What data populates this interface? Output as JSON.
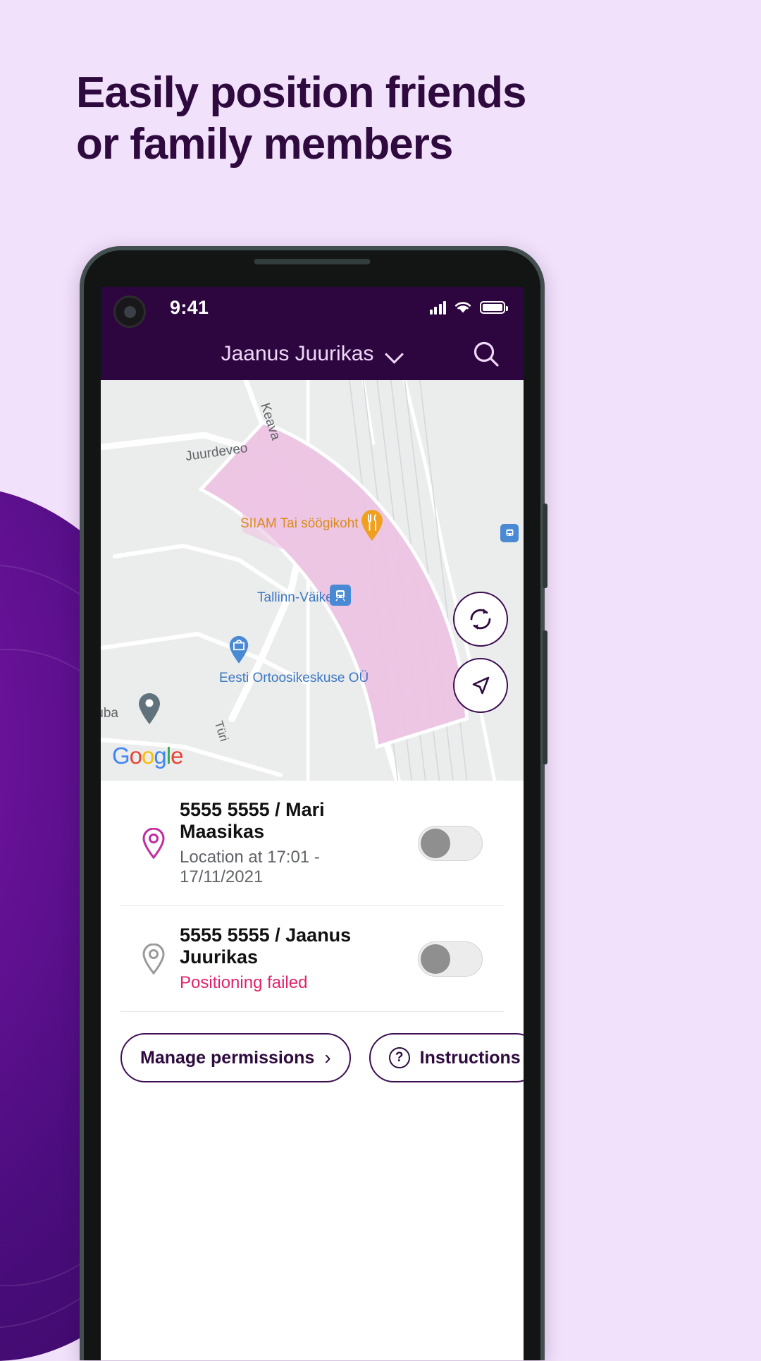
{
  "promo": {
    "headline_line1": "Easily position friends",
    "headline_line2": "or family members",
    "bg_color": "#f2e1fb",
    "text_color": "#2e0a3e"
  },
  "status_bar": {
    "time": "9:41",
    "signal_icon": "cellular-signal-icon",
    "wifi_icon": "wifi-icon",
    "battery_icon": "battery-full-icon"
  },
  "app_header": {
    "title": "Jaanus Juurikas",
    "dropdown_icon": "chevron-down-icon",
    "search_icon": "search-icon",
    "bg_color": "#2d0640"
  },
  "map": {
    "labels": [
      {
        "text": "Keava",
        "type": "street"
      },
      {
        "text": "Juurdeveo",
        "type": "street"
      },
      {
        "text": "SIIAM Tai söögikoht",
        "type": "poi-restaurant"
      },
      {
        "text": "Tallinn-Väike",
        "type": "poi-station"
      },
      {
        "text": "Eesti Ortoosikeskuse OÜ",
        "type": "poi-store"
      },
      {
        "text": "tuba",
        "type": "poi"
      },
      {
        "text": "Türi",
        "type": "street"
      }
    ],
    "attribution": "Google",
    "refresh_icon": "refresh-icon",
    "locate_icon": "navigate-arrow-icon",
    "accuracy_area_color": "#edc3e3"
  },
  "people": [
    {
      "icon": "location-pin-icon",
      "number": "5555 5555 / ",
      "name": "Mari Maasikas",
      "status": "Location at 17:01 - 17/11/2021",
      "status_state": "ok",
      "toggle_on": false
    },
    {
      "icon": "location-pin-icon",
      "number": "5555 5555 / ",
      "name": "Jaanus Juurikas",
      "status": "Positioning failed",
      "status_state": "error",
      "toggle_on": false
    }
  ],
  "actions": {
    "manage_permissions": "Manage permissions",
    "manage_permissions_arrow": "›",
    "instructions": "Instructions",
    "instructions_icon": "question-mark-icon"
  },
  "colors": {
    "accent_purple": "#2d0640",
    "error_pink": "#e0236b",
    "pin_magenta": "#c02d9e"
  }
}
